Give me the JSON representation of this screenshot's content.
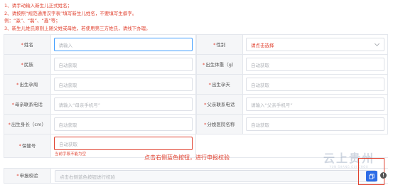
{
  "notice": [
    "1、请手动输入新生儿正式姓名；",
    "2、请按照“规范通用汉字表”填写新生儿姓名，不要填写生僻字。",
    "例：“淼”、“磊”、“鑫”等；",
    "3、新生儿姓氏原则上随父姓或母姓，若使用第三方姓氏，请线下办理。"
  ],
  "fields": {
    "name": {
      "label": "姓名",
      "placeholder": "请输入"
    },
    "gender": {
      "label": "性别",
      "placeholder": "请点击选择"
    },
    "ethnicity": {
      "label": "民族",
      "value": "自动获取"
    },
    "birth_weight": {
      "label": "出生体重（g）",
      "value": "自动获取"
    },
    "birth_date": {
      "label": "出生孕周",
      "value": "自动获取"
    },
    "gestation_days": {
      "label": "出生孕天",
      "value": "自动获取"
    },
    "mother_phone": {
      "label": "母亲联系电话",
      "placeholder": "请输入“母亲手机号”"
    },
    "father_phone": {
      "label": "父亲联系电话",
      "placeholder": "请输入“父亲手机号”"
    },
    "birth_height": {
      "label": "出生身长（cm）",
      "value": "自动获取"
    },
    "hospital": {
      "label": "分娩医院名称",
      "value": "自动获取"
    },
    "insurance": {
      "label": "保健号",
      "value": "自动获取",
      "error": "当前字段不能为空"
    }
  },
  "hint": "点击右侧蓝色按钮，进行申报校验",
  "check": {
    "label": "申报校验",
    "placeholder": "点击右侧蓝色按钮进行校验"
  },
  "watermark": {
    "big": "云上贵州",
    "small": "YUN SHANG GUI ZHOU"
  },
  "colors": {
    "accent": "#2d6ce6",
    "error": "#e0412f",
    "focus": "#409eff"
  }
}
